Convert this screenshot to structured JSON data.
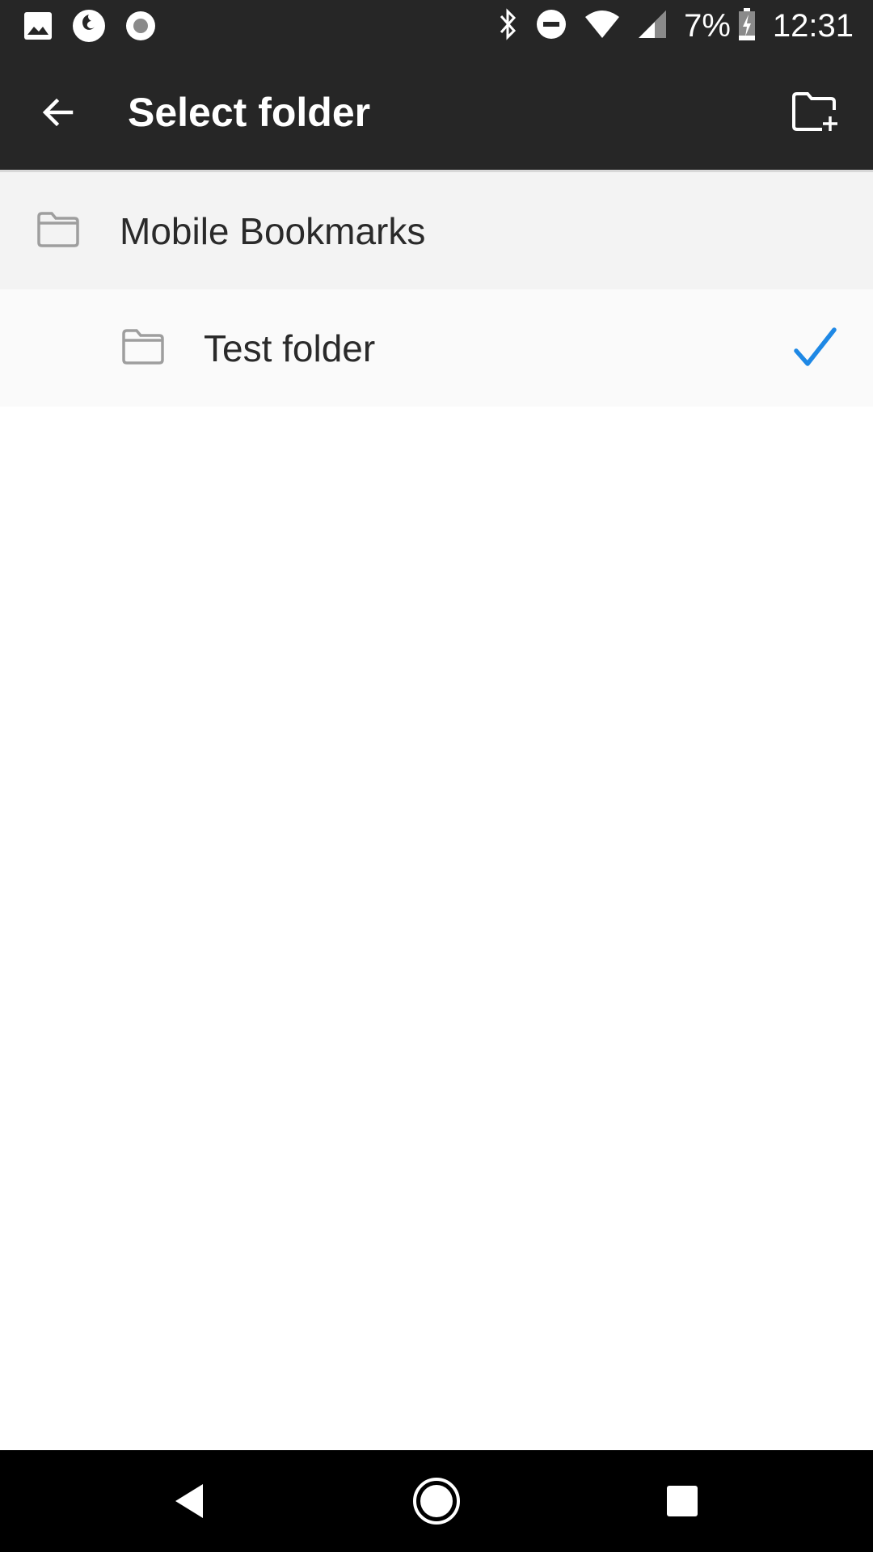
{
  "status_bar": {
    "icons_left": [
      "image-icon",
      "firefox-icon",
      "record-icon"
    ],
    "icons_right": [
      "bluetooth-icon",
      "do-not-disturb-icon",
      "wifi-icon",
      "cell-signal-icon",
      "battery-charging-icon"
    ],
    "battery_percent": "7%",
    "time": "12:31"
  },
  "toolbar": {
    "title": "Select folder",
    "back_icon": "arrow-back-icon",
    "new_folder_icon": "create-new-folder-icon"
  },
  "folders": [
    {
      "label": "Mobile Bookmarks",
      "icon": "folder-icon",
      "level": 0,
      "selected": false
    },
    {
      "label": "Test folder",
      "icon": "folder-icon",
      "level": 1,
      "selected": true
    }
  ],
  "colors": {
    "toolbar_bg": "#262626",
    "check_accent": "#1e88e5",
    "parent_row_bg": "#f3f3f3",
    "child_row_bg": "#fafafa"
  },
  "nav_bar": {
    "buttons": [
      "nav-back-icon",
      "nav-home-icon",
      "nav-recents-icon"
    ]
  }
}
